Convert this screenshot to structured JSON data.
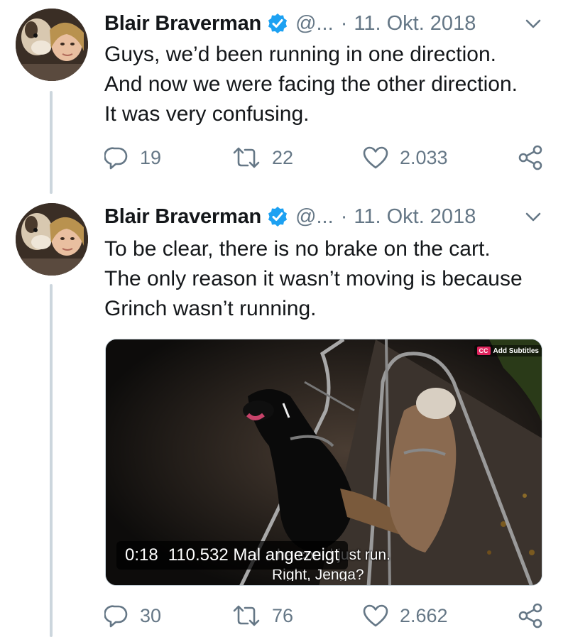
{
  "tweets": [
    {
      "author_name": "Blair Braverman",
      "handle": "@...",
      "separator": "·",
      "date": "11. Okt. 2018",
      "text_lines": [
        "Guys, we’d been running in one direction.",
        "And now we were facing the other direction.",
        "It was very confusing."
      ],
      "replies": "19",
      "retweets": "22",
      "likes": "2.033"
    },
    {
      "author_name": "Blair Braverman",
      "handle": "@...",
      "separator": "·",
      "date": "11. Okt. 2018",
      "text_lines": [
        "To be clear, there is no brake on the cart.",
        "The only reason it wasn’t moving is because",
        "Grinch wasn’t running."
      ],
      "replies": "30",
      "retweets": "76",
      "likes": "2.662"
    }
  ],
  "video": {
    "cc_badge": "CC",
    "cc_label": "Add Subtitles",
    "time": "0:18",
    "views_label": "110.532 Mal angezeigt",
    "subtitle_line1": "he could just run.",
    "subtitle_line2": "Right, Jenga?"
  },
  "colors": {
    "accent": "#1da1f2",
    "muted": "#657786",
    "text": "#14171a",
    "thread_line": "#ccd6dd"
  },
  "icons": {
    "verified": "verified-badge-icon",
    "caret": "chevron-down-icon",
    "reply": "reply-icon",
    "retweet": "retweet-icon",
    "like": "heart-icon",
    "share": "share-icon"
  }
}
